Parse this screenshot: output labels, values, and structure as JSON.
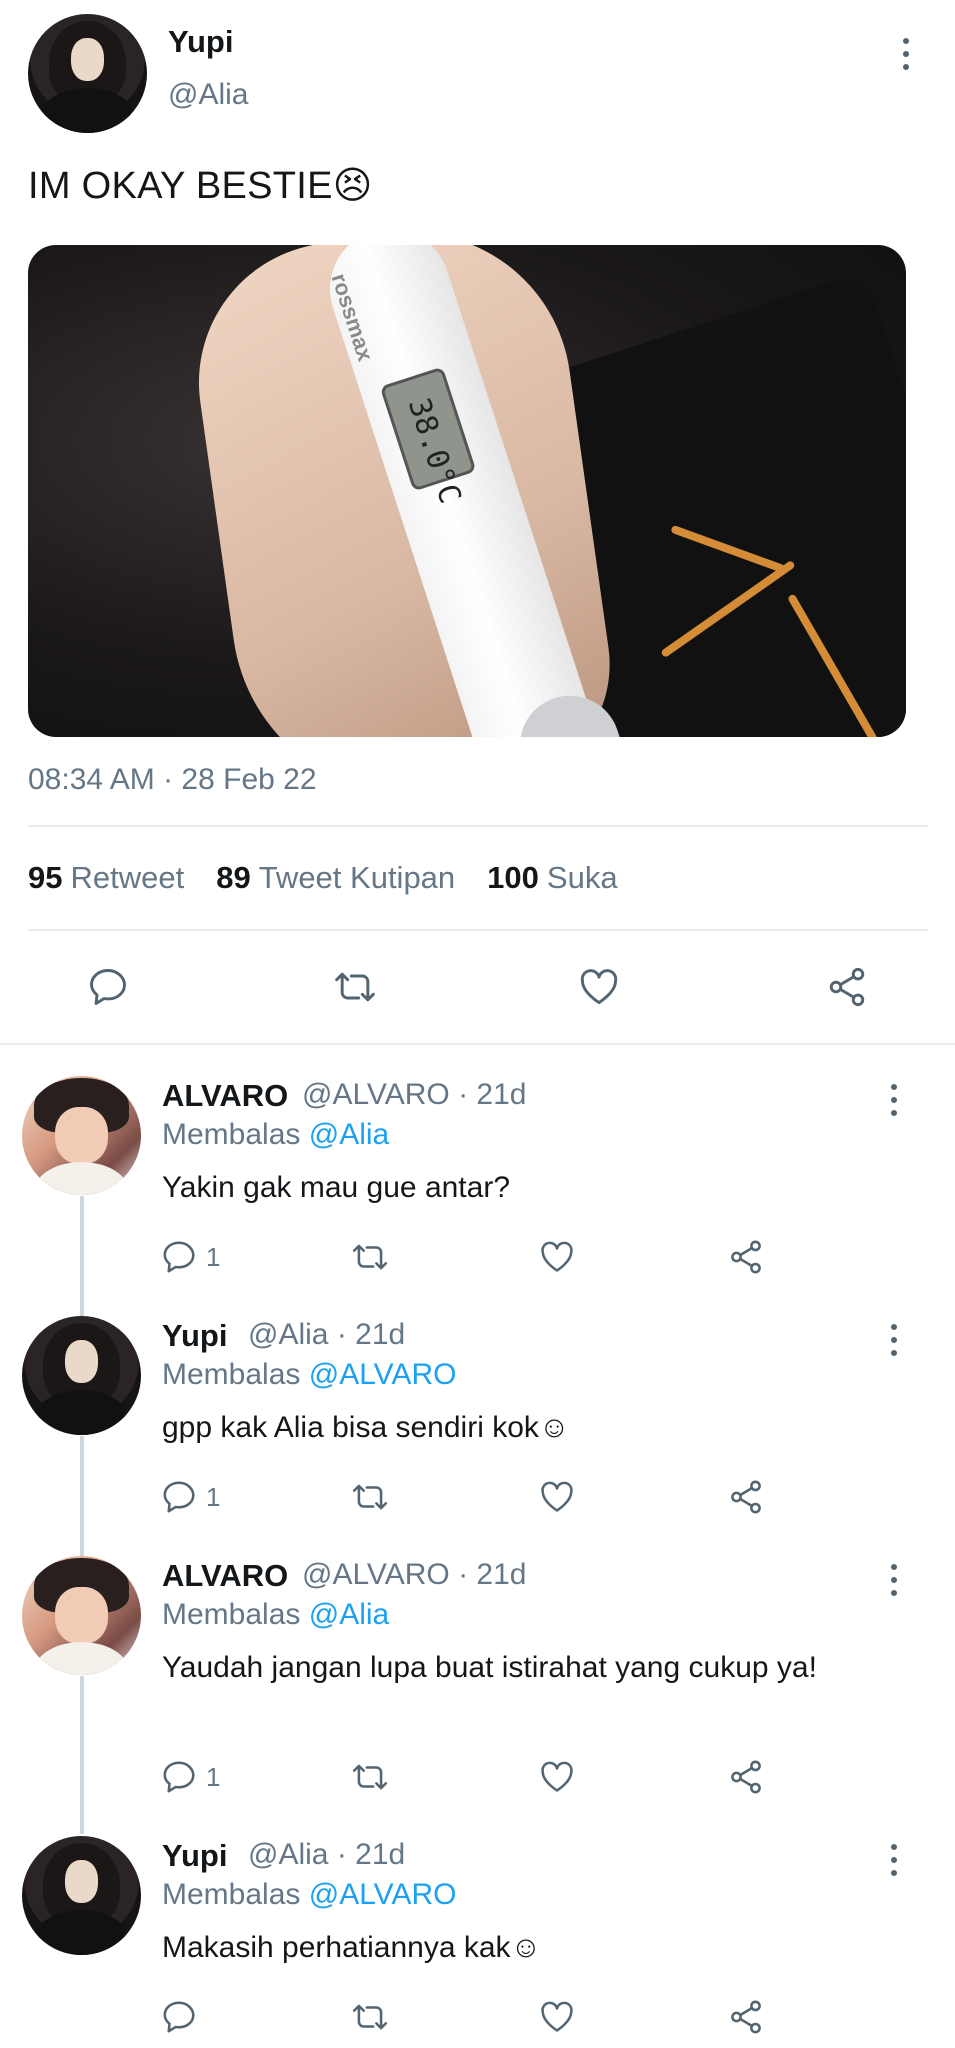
{
  "tweet": {
    "name": "Yupi",
    "handle": "@Alia",
    "text": "IM OKAY BESTIE😣",
    "media_texts": {
      "brand": "rossmax",
      "reading": "38.0°C"
    },
    "timestamp": "08:34 AM · 28 Feb 22",
    "stats": [
      {
        "value": "95",
        "label": "Retweet"
      },
      {
        "value": "89",
        "label": "Tweet Kutipan"
      },
      {
        "value": "100",
        "label": "Suka"
      }
    ],
    "actions": [
      "reply-icon",
      "retweet-icon",
      "like-icon",
      "share-icon"
    ]
  },
  "replies": [
    {
      "name": "ALVARO",
      "handle": "@ALVARO",
      "time": "· 21d",
      "reply_prefix": "Membalas",
      "reply_mention": "@Alia",
      "text": "Yakin gak mau gue antar?",
      "reply_count": "1"
    },
    {
      "name": "Yupi",
      "handle": "@Alia",
      "time": "· 21d",
      "reply_prefix": "Membalas",
      "reply_mention": "@ALVARO",
      "text": "gpp kak Alia bisa sendiri kok☺",
      "reply_count": "1"
    },
    {
      "name": "ALVARO",
      "handle": "@ALVARO",
      "time": "· 21d",
      "reply_prefix": "Membalas",
      "reply_mention": "@Alia",
      "text": "Yaudah jangan lupa buat istirahat yang cukup ya!",
      "reply_count": "1"
    },
    {
      "name": "Yupi",
      "handle": "@Alia",
      "time": "· 21d",
      "reply_prefix": "Membalas",
      "reply_mention": "@ALVARO",
      "text": "Makasih perhatiannya kak☺",
      "reply_count": ""
    }
  ],
  "colors": {
    "link": "#1da1f2",
    "secondary": "#657786",
    "text": "#14171a",
    "divider": "#e6ecf0"
  }
}
